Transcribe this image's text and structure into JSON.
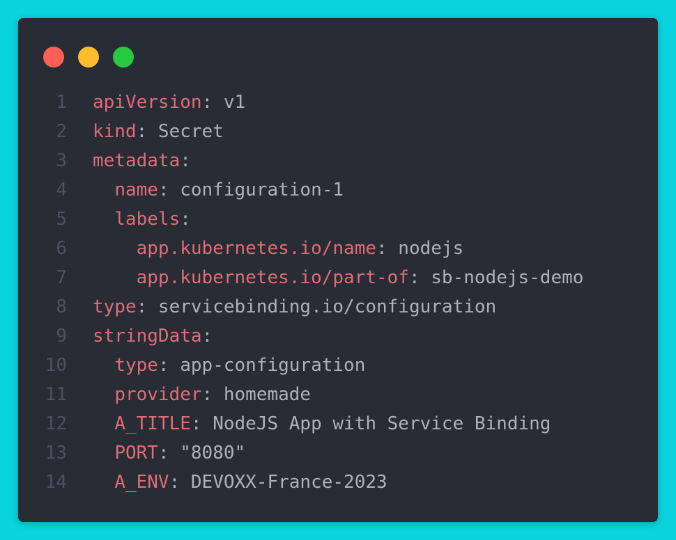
{
  "window": {
    "controls": [
      "close",
      "minimize",
      "maximize"
    ],
    "colors": {
      "background": "#282c34",
      "key": "#e06c75",
      "value": "#abb2bf",
      "line_number": "#4b5263"
    }
  },
  "code": {
    "lines": [
      {
        "num": "1",
        "indent": "",
        "key": "apiVersion",
        "sep": ":",
        "value": " v1"
      },
      {
        "num": "2",
        "indent": "",
        "key": "kind",
        "sep": ":",
        "value": " Secret"
      },
      {
        "num": "3",
        "indent": "",
        "key": "metadata",
        "sep": ":",
        "value": ""
      },
      {
        "num": "4",
        "indent": "  ",
        "key": "name",
        "sep": ":",
        "value": " configuration-1"
      },
      {
        "num": "5",
        "indent": "  ",
        "key": "labels",
        "sep": ":",
        "value": ""
      },
      {
        "num": "6",
        "indent": "    ",
        "key": "app.kubernetes.io/name",
        "sep": ":",
        "value": " nodejs"
      },
      {
        "num": "7",
        "indent": "    ",
        "key": "app.kubernetes.io/part-of",
        "sep": ":",
        "value": " sb-nodejs-demo"
      },
      {
        "num": "8",
        "indent": "",
        "key": "type",
        "sep": ":",
        "value": " servicebinding.io/configuration"
      },
      {
        "num": "9",
        "indent": "",
        "key": "stringData",
        "sep": ":",
        "value": ""
      },
      {
        "num": "10",
        "indent": "  ",
        "key": "type",
        "sep": ":",
        "value": " app-configuration"
      },
      {
        "num": "11",
        "indent": "  ",
        "key": "provider",
        "sep": ":",
        "value": " homemade"
      },
      {
        "num": "12",
        "indent": "  ",
        "key": "A_TITLE",
        "sep": ":",
        "value": " NodeJS App with Service Binding"
      },
      {
        "num": "13",
        "indent": "  ",
        "key": "PORT",
        "sep": ":",
        "value": " \"8080\""
      },
      {
        "num": "14",
        "indent": "  ",
        "key": "A_ENV",
        "sep": ":",
        "value": " DEVOXX-France-2023"
      }
    ]
  }
}
